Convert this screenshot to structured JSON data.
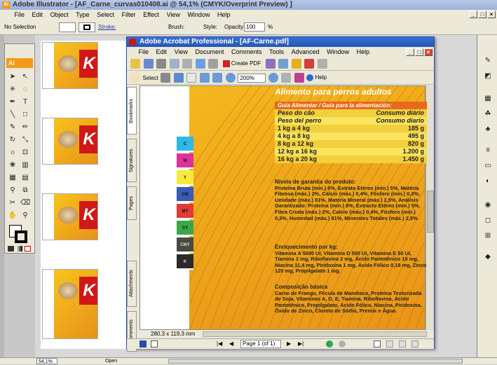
{
  "illustrator": {
    "title": "Adobe Illustrator - [AF_Carne_curvas010408.ai @ 54,1% (CMYK/Overprint Preview) ]",
    "menu": [
      "File",
      "Edit",
      "Object",
      "Type",
      "Select",
      "Filter",
      "Effect",
      "View",
      "Window",
      "Help"
    ],
    "control": {
      "selection": "No Selection",
      "stroke_label": "Stroke:",
      "brush_label": "Brush:",
      "style_label": "Style:",
      "opacity_label": "Opacity:",
      "opacity_value": "100",
      "pct": "%"
    },
    "status": {
      "zoom": "54,1%",
      "state": "Open"
    },
    "tools_label": "Ai",
    "label_letter": "K"
  },
  "acrobat": {
    "title": "Adobe Acrobat Professional - [AF-Carne.pdf]",
    "menu": [
      "File",
      "Edit",
      "View",
      "Document",
      "Comments",
      "Tools",
      "Advanced",
      "Window",
      "Help"
    ],
    "toolbar": {
      "create_pdf": "Create PDF",
      "select": "Select",
      "zoom": "200%",
      "help": "Help"
    },
    "side_tabs": [
      "Bookmarks",
      "Signatures",
      "Pages",
      "Attachments",
      "Comments"
    ],
    "swatches": [
      {
        "label": "C",
        "color": "#2fb7e8"
      },
      {
        "label": "M",
        "color": "#e0309a"
      },
      {
        "label": "Y",
        "color": "#f6ea3c"
      },
      {
        "label": "CM",
        "color": "#3a5bb4"
      },
      {
        "label": "MY",
        "color": "#e23a36"
      },
      {
        "label": "CY",
        "color": "#3aa84a"
      },
      {
        "label": "CMY",
        "color": "#4a4a44"
      },
      {
        "label": "K",
        "color": "#2a2a2a"
      }
    ],
    "doc": {
      "heading": "Alimento para perros adultos",
      "guide_title": "Guia Alimentar / Guía para la alimentación:",
      "table": [
        {
          "a": "Peso do cão",
          "b": "Consumo diário"
        },
        {
          "a": "Peso del perro",
          "b": "Consumo diario"
        },
        {
          "a": "1 kg a 4 kg",
          "b": "185 g"
        },
        {
          "a": "4 kg a 8 kg",
          "b": "495 g"
        },
        {
          "a": "8 kg a 12 kg",
          "b": "820 g"
        },
        {
          "a": "12 kg a 16 kg",
          "b": "1.200 g"
        },
        {
          "a": "16 kg a 20 kg",
          "b": "1.450 g"
        }
      ],
      "niveis_title": "Níveis de garantia do produto:",
      "niveis_text": "Proteína Bruta (mín.) 8%, Extrato Etéreo (mín.) 5%, Matéria Fibrosa (máx.) 2%, Cálcio (máx.) 0,4%, Fósforo (mín.) 0,3%, Umidade (máx.) 81%, Matéria Mineral (máx.) 2,5%. Análisis Garantizado: Proteína (mín.) 8%, Extracto Etéreo (mín.) 5%, Fibra Cruda (máx.) 2%, Calcio (máx.) 0,4%, Fósforo (mín.) 0,3%, Humedad (máx.) 81%, Minerales Totales (máx.) 2,5%.",
      "enriq_title": "Enriquecimento por kg:",
      "enriq_text": "Vitamina A 5000 UI, Vitamina D 500 UI, Vitamina E 50 UI, Tiamina 1 mg, Riboflavina 2 mg, Ácido Pantotênico 10 mg, Niacina 11,4 mg, Piridoxina 1 mg, Ácido Fólico 0,18 mg, Zinco 120 mg, Propilgalato 1 mg.",
      "comp_title": "Composição básica",
      "comp_text": "Carne de Frango, Fécula de Mandioca, Proteína Texturizada de Soja, Vitaminas A, D, E, Tiamina, Riboflavina, Ácido Pantotênico, Propilgalato, Ácido Fólico, Niacina, Piridoxina, Óxido de Zinco, Cloreto de Sódio, Premix e Água."
    },
    "dimensions": "280,3 x 119,3 mm",
    "page_nav": "Page 1 (of 1)"
  }
}
